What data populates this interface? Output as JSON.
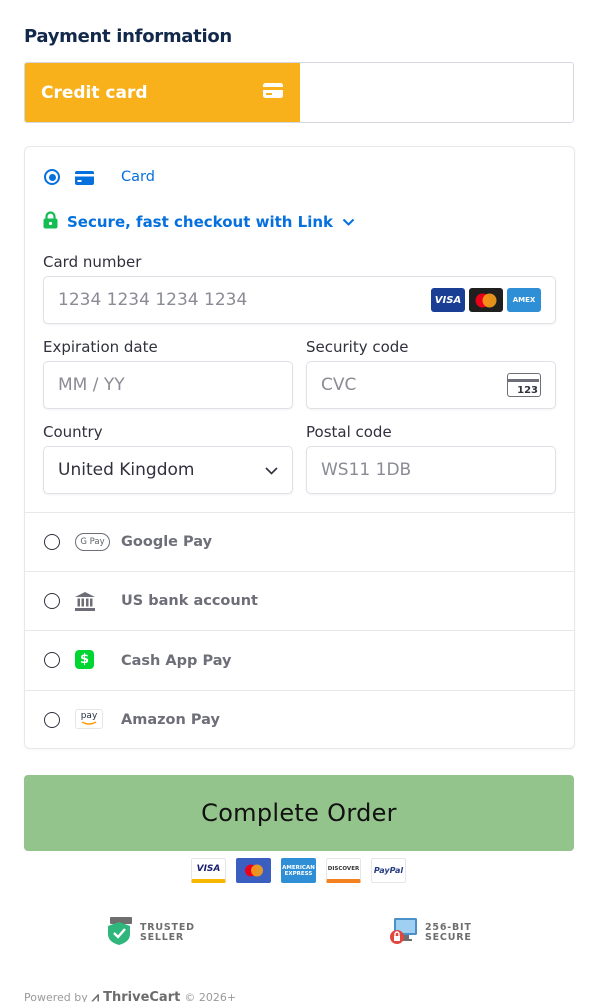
{
  "header": {
    "title": "Payment information"
  },
  "tabs": {
    "credit_card_label": "Credit card"
  },
  "card_method": {
    "label": "Card",
    "link_text": "Secure, fast checkout with Link",
    "card_number": {
      "label": "Card number",
      "placeholder": "1234 1234 1234 1234"
    },
    "brands": [
      "VISA",
      "mastercard",
      "AMEX"
    ],
    "expiration": {
      "label": "Expiration date",
      "placeholder": "MM / YY"
    },
    "security": {
      "label": "Security code",
      "placeholder": "CVC",
      "icon_text": "123"
    },
    "country": {
      "label": "Country",
      "value": "United Kingdom"
    },
    "postal": {
      "label": "Postal code",
      "placeholder": "WS11 1DB"
    }
  },
  "other_methods": [
    {
      "label": "Google Pay",
      "icon_text": "G Pay"
    },
    {
      "label": "US bank account"
    },
    {
      "label": "Cash App Pay",
      "icon_text": "$"
    },
    {
      "label": "Amazon Pay",
      "icon_text": "pay"
    }
  ],
  "order_button": {
    "label": "Complete Order"
  },
  "payment_logos": [
    "VISA",
    "MC",
    "AMERICAN EXPRESS",
    "DISCOVER",
    "PayPal"
  ],
  "trust_badges": {
    "trusted": "TRUSTED SELLER",
    "secure": "256-BIT SECURE"
  },
  "footer": {
    "powered_by": "Powered by",
    "brand": "ThriveCart",
    "copyright": "© 2026+"
  },
  "colors": {
    "accent": "#f8b11a",
    "link_blue": "#0570de",
    "order_button": "#93c48b"
  }
}
